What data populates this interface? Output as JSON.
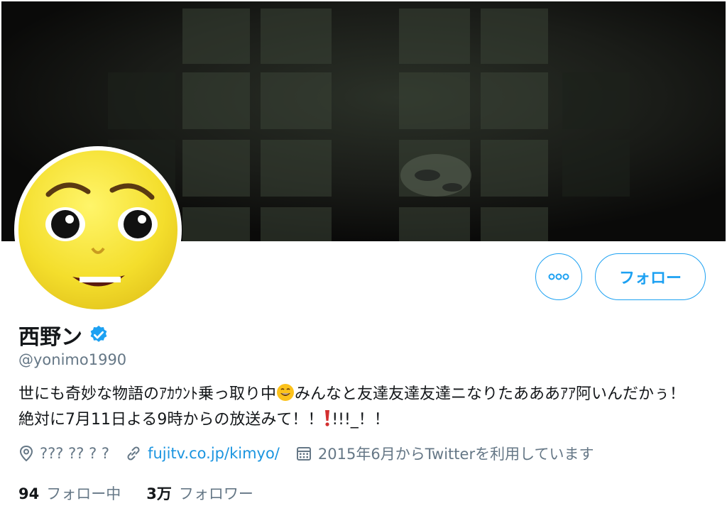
{
  "banner": {
    "image": "dark-shoji-window-photo"
  },
  "avatar": {
    "image": "yellow-face-avatar"
  },
  "actions": {
    "more_icon": "more-dots-icon",
    "follow_label": "フォロー"
  },
  "profile": {
    "name": "西野ン",
    "verified_icon": "verified-badge-icon",
    "handle": "@yonimo1990",
    "bio_part1": "世にも奇妙な物語のｱｶｳﾝﾄ乗っ取り中",
    "bio_emoji": "grinning-face-icon",
    "bio_part2": "みんなと友達友達友達ニなりたあああｱｱ阿いんだかぅ！絶対に7月11日よる9時からの放送みて！！",
    "bio_exclaim_icon": "red-exclamation-icon",
    "bio_part3": "!!!_！！"
  },
  "meta": {
    "location_icon": "location-pin-icon",
    "location": "??? ?? ? ?",
    "link_icon": "link-icon",
    "link": "fujitv.co.jp/kimyo/",
    "calendar_icon": "calendar-icon",
    "joined": "2015年6月からTwitterを利用しています"
  },
  "stats": {
    "following_count": "94",
    "following_label": "フォロー中",
    "followers_count": "3万",
    "followers_label": "フォロワー"
  },
  "colors": {
    "accent": "#1da1f2",
    "link": "#1b95e0",
    "secondary_text": "#657786",
    "primary_text": "#14171a"
  }
}
